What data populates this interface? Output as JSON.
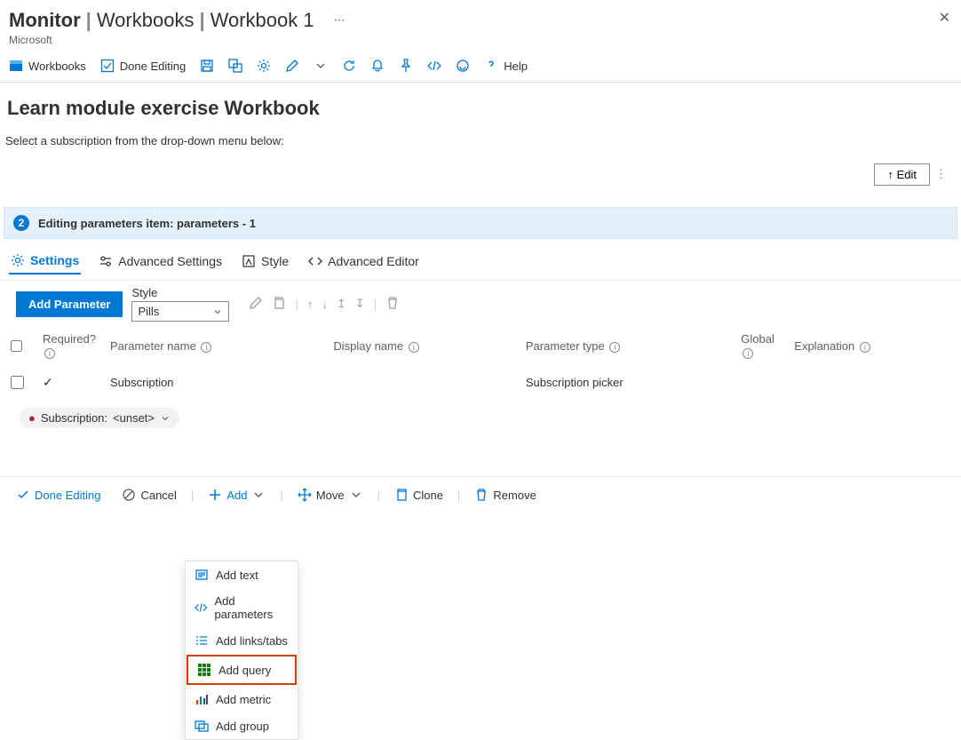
{
  "breadcrumb": {
    "part1": "Monitor",
    "part2": "Workbooks",
    "part3": "Workbook 1"
  },
  "provider": "Microsoft",
  "toolbar": {
    "workbooks": "Workbooks",
    "done_editing": "Done Editing",
    "help": "Help"
  },
  "page": {
    "title": "Learn module exercise Workbook",
    "desc": "Select a subscription from the drop-down menu below:",
    "edit_btn": "Edit"
  },
  "editing": {
    "badge": "2",
    "label": "Editing parameters item: parameters - 1"
  },
  "tabs": {
    "settings": "Settings",
    "advanced": "Advanced Settings",
    "style": "Style",
    "editor": "Advanced Editor"
  },
  "param_toolbar": {
    "add": "Add Parameter",
    "style_label": "Style",
    "style_value": "Pills"
  },
  "columns": {
    "required": "Required?",
    "name": "Parameter name",
    "display": "Display name",
    "type": "Parameter type",
    "global": "Global",
    "explanation": "Explanation"
  },
  "row": {
    "name": "Subscription",
    "type": "Subscription picker"
  },
  "ctx": {
    "text": "Add text",
    "params": "Add parameters",
    "links": "Add links/tabs",
    "query": "Add query",
    "metric": "Add metric",
    "group": "Add group"
  },
  "pill": {
    "label": "Subscription:",
    "value": "<unset>"
  },
  "bottom": {
    "done": "Done Editing",
    "cancel": "Cancel",
    "add": "Add",
    "move": "Move",
    "clone": "Clone",
    "remove": "Remove"
  }
}
